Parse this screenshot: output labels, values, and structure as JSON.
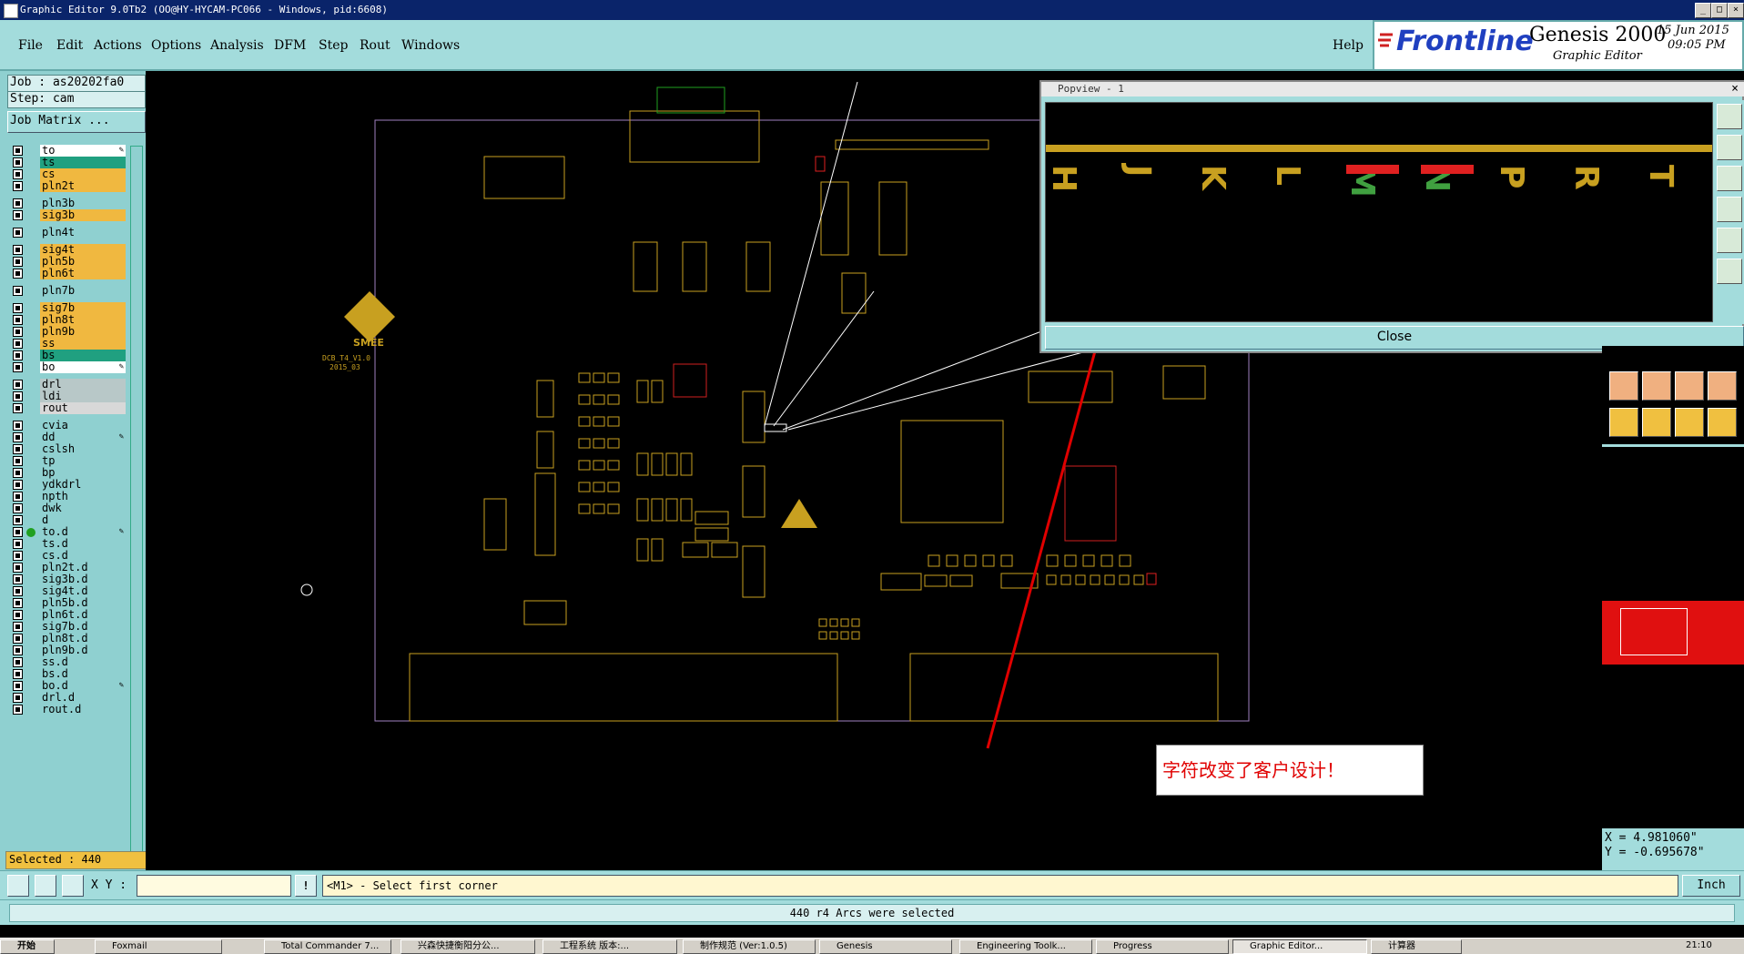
{
  "window": {
    "title": "Graphic Editor 9.0Tb2 (OO@HY-HYCAM-PC066 - Windows, pid:6608)",
    "controls": [
      "_",
      "□",
      "×"
    ]
  },
  "menu": {
    "items": [
      "File",
      "Edit",
      "Actions",
      "Options",
      "Analysis",
      "DFM",
      "Step",
      "Rout",
      "Windows"
    ],
    "help": "Help"
  },
  "brand": {
    "logo": "Frontline",
    "product": "Genesis 2000",
    "subtitle": "Graphic Editor",
    "date": "15 Jun 2015",
    "time": "09:05 PM"
  },
  "job": {
    "job_line": "Job : as20202fa0",
    "step_line": "Step: cam",
    "matrix_button": "Job Matrix ..."
  },
  "layers": [
    {
      "name": "to",
      "color": "#ffffff",
      "flag": "✎",
      "active": true
    },
    {
      "name": "ts",
      "color": "#20a080"
    },
    {
      "name": "cs",
      "color": "#f0b840"
    },
    {
      "name": "pln2t",
      "color": "#f0b840"
    },
    {
      "name": "pln3b",
      "color": "#8fd0d0"
    },
    {
      "name": "sig3b",
      "color": "#f0b840"
    },
    {
      "name": "pln4t",
      "color": "#8fd0d0"
    },
    {
      "name": "sig4t",
      "color": "#f0b840"
    },
    {
      "name": "pln5b",
      "color": "#f0b840"
    },
    {
      "name": "pln6t",
      "color": "#f0b840"
    },
    {
      "name": "pln7b",
      "color": "#8fd0d0"
    },
    {
      "name": "sig7b",
      "color": "#f0b840"
    },
    {
      "name": "pln8t",
      "color": "#f0b840"
    },
    {
      "name": "pln9b",
      "color": "#f0b840"
    },
    {
      "name": "ss",
      "color": "#f0b840"
    },
    {
      "name": "bs",
      "color": "#20a080"
    },
    {
      "name": "bo",
      "color": "#ffffff",
      "flag": "✎"
    },
    {
      "name": "drl",
      "color": "#b8c8c8"
    },
    {
      "name": "ldi",
      "color": "#b8c8c8"
    },
    {
      "name": "rout",
      "color": "#d8d8d8"
    },
    {
      "name": "cvia",
      "color": "#8fd0d0"
    },
    {
      "name": "dd",
      "color": "#8fd0d0",
      "flag": "✎"
    },
    {
      "name": "cslsh",
      "color": "#8fd0d0"
    },
    {
      "name": "tp",
      "color": "#8fd0d0"
    },
    {
      "name": "bp",
      "color": "#8fd0d0"
    },
    {
      "name": "ydkdrl",
      "color": "#8fd0d0"
    },
    {
      "name": "npth",
      "color": "#8fd0d0"
    },
    {
      "name": "dwk",
      "color": "#8fd0d0"
    },
    {
      "name": "d",
      "color": "#8fd0d0"
    },
    {
      "name": "to.d",
      "color": "#8fd0d0",
      "flag": "✎",
      "dot": "#20a020"
    },
    {
      "name": "ts.d",
      "color": "#8fd0d0"
    },
    {
      "name": "cs.d",
      "color": "#8fd0d0"
    },
    {
      "name": "pln2t.d",
      "color": "#8fd0d0"
    },
    {
      "name": "sig3b.d",
      "color": "#8fd0d0"
    },
    {
      "name": "sig4t.d",
      "color": "#8fd0d0"
    },
    {
      "name": "pln5b.d",
      "color": "#8fd0d0"
    },
    {
      "name": "pln6t.d",
      "color": "#8fd0d0"
    },
    {
      "name": "sig7b.d",
      "color": "#8fd0d0"
    },
    {
      "name": "pln8t.d",
      "color": "#8fd0d0"
    },
    {
      "name": "pln9b.d",
      "color": "#8fd0d0"
    },
    {
      "name": "ss.d",
      "color": "#8fd0d0"
    },
    {
      "name": "bs.d",
      "color": "#8fd0d0"
    },
    {
      "name": "bo.d",
      "color": "#8fd0d0",
      "flag": "✎"
    },
    {
      "name": "drl.d",
      "color": "#8fd0d0"
    },
    {
      "name": "rout.d",
      "color": "#8fd0d0"
    }
  ],
  "selected_label": "Selected : 440",
  "board": {
    "logo_text": "SMEE",
    "board_label_1": "DCB_T4_V1.0",
    "board_label_2": "2015_03"
  },
  "popview": {
    "title": "Popview - 1",
    "letters": [
      "H",
      "J",
      "K",
      "L",
      "M",
      "N",
      "P",
      "R",
      "T"
    ],
    "close_label": "Close"
  },
  "annotation": {
    "text": "字符改变了客户设计！",
    "color": "#e00000"
  },
  "coords": {
    "x": "X = 4.981060\"",
    "y": "Y = -0.695678\""
  },
  "command": {
    "xy_label": "X Y :",
    "xy_value": "",
    "prompt": "<M1> - Select first corner",
    "units": "Inch"
  },
  "status": {
    "message": "440 r4 Arcs were selected"
  },
  "taskbar": {
    "start": "开始",
    "tasks": [
      "Foxmail",
      "Total Commander 7...",
      "兴森快捷衡阳分公...",
      "工程系统   版本:...",
      "制作规范 (Ver:1.0.5)",
      "Genesis",
      "Engineering Toolk...",
      "Progress",
      "Graphic Editor...",
      "计算器"
    ],
    "clock": "21:10"
  },
  "colors": {
    "panel": "#a3dcdc",
    "silkscreen": "#c8a020",
    "highlight": "#e02020",
    "arrow": "#e00000"
  }
}
